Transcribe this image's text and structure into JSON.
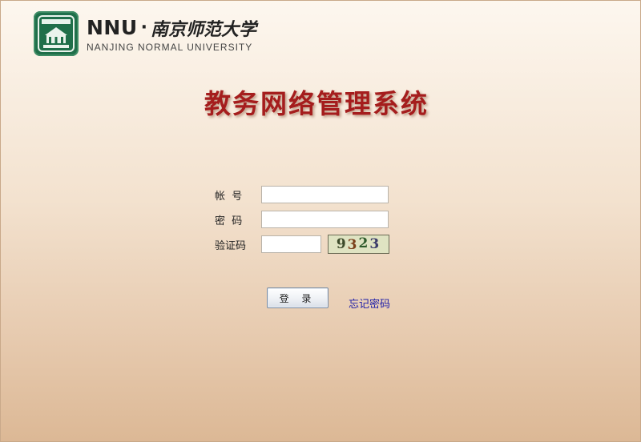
{
  "header": {
    "logo_abbr": "NNU",
    "logo_separator": "·",
    "logo_cn": "南京师范大学",
    "logo_en": "NANJING NORMAL UNIVERSITY"
  },
  "title": "教务网络管理系统",
  "form": {
    "account_label": "帐  号",
    "account_value": "",
    "password_label": "密  码",
    "password_value": "",
    "captcha_label": "验证码",
    "captcha_value": "",
    "captcha_chars": [
      "9",
      "3",
      "2",
      "3"
    ]
  },
  "actions": {
    "login_label": "登 录",
    "forgot_label": "忘记密码"
  },
  "colors": {
    "title": "#a51d1d",
    "link": "#1b1ba8",
    "emblem": "#1f6f4a"
  }
}
